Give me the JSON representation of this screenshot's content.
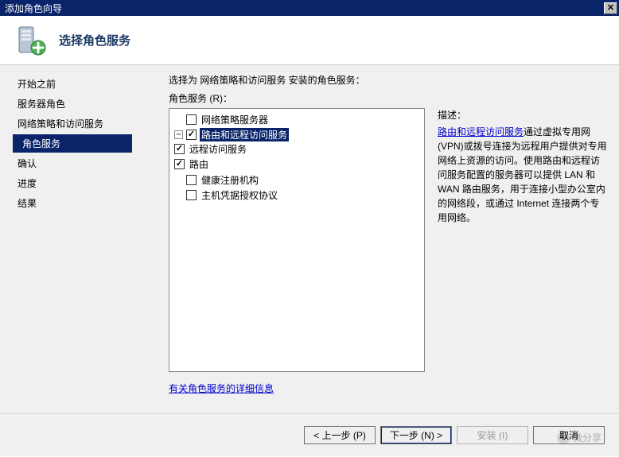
{
  "window": {
    "title": "添加角色向导",
    "close_glyph": "✕"
  },
  "header": {
    "title": "选择角色服务"
  },
  "sidebar": {
    "items": [
      {
        "label": "开始之前",
        "active": false
      },
      {
        "label": "服务器角色",
        "active": false
      },
      {
        "label": "网络策略和访问服务",
        "active": false
      },
      {
        "label": "角色服务",
        "active": true,
        "indent": true
      },
      {
        "label": "确认",
        "active": false
      },
      {
        "label": "进度",
        "active": false
      },
      {
        "label": "结果",
        "active": false
      }
    ]
  },
  "main": {
    "instruction": "选择为 网络策略和访问服务 安装的角色服务：",
    "section_label": "角色服务 (R)：",
    "tree": [
      {
        "label": "网络策略服务器",
        "checked": false,
        "selected": false,
        "expander": "none"
      },
      {
        "label": "路由和远程访问服务",
        "checked": true,
        "selected": true,
        "expander": "minus",
        "children": [
          {
            "label": "远程访问服务",
            "checked": true
          },
          {
            "label": "路由",
            "checked": true
          }
        ]
      },
      {
        "label": "健康注册机构",
        "checked": false,
        "selected": false,
        "expander": "none"
      },
      {
        "label": "主机凭据授权协议",
        "checked": false,
        "selected": false,
        "expander": "none"
      }
    ],
    "desc_heading": "描述：",
    "desc_link": "路由和远程访问服务",
    "desc_rest": "通过虚拟专用网(VPN)或拨号连接为远程用户提供对专用网络上资源的访问。使用路由和远程访问服务配置的服务器可以提供 LAN 和 WAN 路由服务，用于连接小型办公室内的网络段，或通过 Internet 连接两个专用网络。",
    "more_link": "有关角色服务的详细信息"
  },
  "footer": {
    "prev": "< 上一步 (P)",
    "next": "下一步 (N) >",
    "install": "安装 (I)",
    "cancel": "取消"
  },
  "watermark": {
    "text": "微分享"
  }
}
